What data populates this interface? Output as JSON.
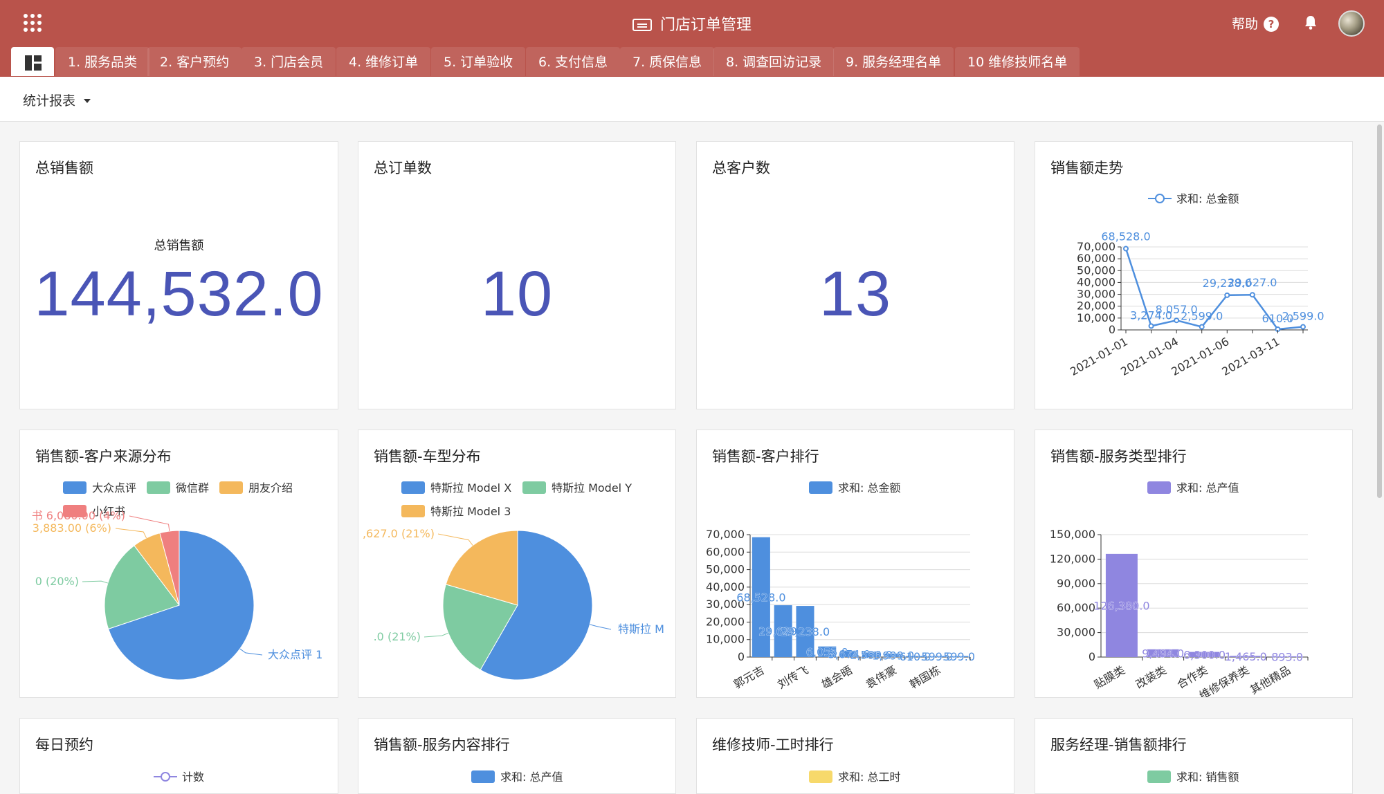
{
  "app": {
    "title": "门店订单管理",
    "help_label": "帮助",
    "help_icon": "?"
  },
  "tabs": [
    {
      "label": "1. 服务品类"
    },
    {
      "label": "2. 客户预约"
    },
    {
      "label": "3. 门店会员"
    },
    {
      "label": "4. 维修订单"
    },
    {
      "label": "5. 订单验收"
    },
    {
      "label": "6. 支付信息"
    },
    {
      "label": "7. 质保信息"
    },
    {
      "label": "8. 调查回访记录"
    },
    {
      "label": "9. 服务经理名单"
    },
    {
      "label": "10 维修技师名单"
    }
  ],
  "report_selector": {
    "label": "统计报表"
  },
  "colors": {
    "brand": "#b9534b",
    "kpi": "#4a55b6",
    "series_blue": "#4e8fde",
    "series_green": "#7ecba1",
    "series_orange": "#f4b85c",
    "series_red": "#ef7f7f",
    "series_purple": "#8f86e0",
    "series_yellow": "#f7d96b"
  },
  "kpis": [
    {
      "title": "总销售额",
      "label": "总销售额",
      "value": "144,532.0"
    },
    {
      "title": "总订单数",
      "label": "",
      "value": "10"
    },
    {
      "title": "总客户数",
      "label": "",
      "value": "13"
    }
  ],
  "cards_row3": [
    {
      "title": "每日预约",
      "legend": "计数"
    },
    {
      "title": "销售额-服务内容排行",
      "legend": "求和: 总产值"
    },
    {
      "title": "维修技师-工时排行",
      "legend": "求和: 总工时"
    },
    {
      "title": "服务经理-销售额排行",
      "legend": "求和: 销售额"
    }
  ],
  "chart_data": [
    {
      "type": "line",
      "title": "销售额走势",
      "series": [
        {
          "name": "求和: 总金额",
          "values": [
            68528.0,
            3274.0,
            8057.0,
            2599.0,
            29238.0,
            29627.0,
            610.0,
            2599.0
          ]
        }
      ],
      "x": [
        "2021-01-01",
        "",
        "2021-01-04",
        "",
        "2021-01-06",
        "",
        "2021-03-11",
        ""
      ],
      "data_labels": [
        "68,528.0",
        "3,274.0",
        "8,057.0",
        "2,599.0",
        "29,238.0",
        "29,627.0",
        "610.0",
        "2,599.0"
      ],
      "yticks": [
        "0",
        "10,000",
        "20,000",
        "30,000",
        "40,000",
        "50,000",
        "60,000",
        "70,000"
      ],
      "ylim": [
        0,
        70000
      ],
      "grid": true,
      "legend_position": "top-center"
    },
    {
      "type": "pie",
      "title": "销售额-客户来源分布",
      "legend": [
        "大众点评",
        "微信群",
        "朋友介绍",
        "小红书"
      ],
      "values": [
        101583.0,
        28906.0,
        8883.0,
        6080.0
      ],
      "slice_labels": [
        "大众点评 1",
        "0 (20%)",
        "3,883.00 (6%)",
        "书 6,080.00 (4%)"
      ],
      "legend_position": "top-center"
    },
    {
      "type": "pie",
      "title": "销售额-车型分布",
      "legend": [
        "特斯拉 Model X",
        "特斯拉 Model Y",
        "特斯拉 Model 3"
      ],
      "values": [
        84278.0,
        30627.0,
        29627.0
      ],
      "slice_labels": [
        "特斯拉 M",
        ".0 (21%)",
        ",627.0 (21%)"
      ],
      "legend_position": "top-center"
    },
    {
      "type": "bar",
      "title": "销售额-客户排行",
      "series": [
        {
          "name": "求和: 总金额",
          "values": [
            68528.0,
            29629.0,
            29238.0,
            6055.0,
            3674.0,
            2599.0,
            1999.0,
            610.0,
            599.0,
            599.0
          ]
        }
      ],
      "x": [
        "郭元吉",
        "",
        "刘传飞",
        "",
        "雄会晤",
        "",
        "袁伟豪",
        "",
        "韩国栋",
        ""
      ],
      "data_labels": [
        "68,528.0",
        "29,629.0",
        "29,238.0",
        "6,055.0",
        "3,674.0",
        "2,599.0",
        "1,999.0",
        "610.0",
        "599.0",
        "599.0"
      ],
      "yticks": [
        "0",
        "10,000",
        "20,000",
        "30,000",
        "40,000",
        "50,000",
        "60,000",
        "70,000"
      ],
      "ylim": [
        0,
        70000
      ],
      "grid": true,
      "legend_position": "top-center"
    },
    {
      "type": "bar",
      "title": "销售额-服务类型排行",
      "series": [
        {
          "name": "求和: 总产值",
          "values": [
            126380.0,
            9494.0,
            6300.0,
            1465.0,
            893.0
          ]
        }
      ],
      "x": [
        "贴膜类",
        "改装类",
        "合作类",
        "维修保养类",
        "其他精品"
      ],
      "data_labels": [
        "126,380.0",
        "9,494.0",
        "6,300.0",
        "1,465.0",
        "893.0"
      ],
      "yticks": [
        "0",
        "30,000",
        "60,000",
        "90,000",
        "120,000",
        "150,000"
      ],
      "ylim": [
        0,
        150000
      ],
      "grid": true,
      "legend_position": "top-center"
    }
  ]
}
